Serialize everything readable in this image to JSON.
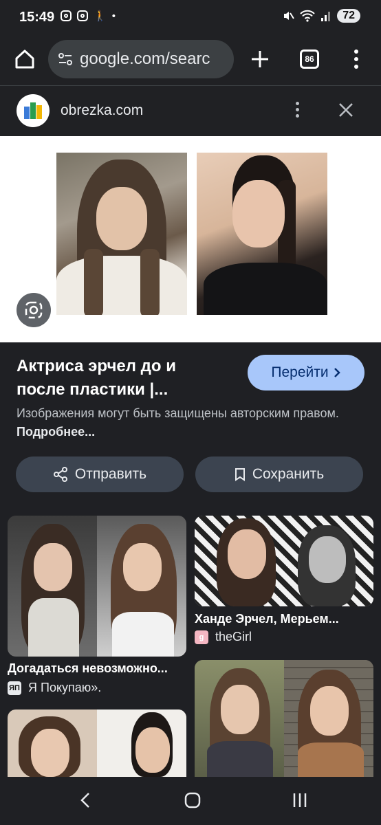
{
  "status_bar": {
    "time": "15:49",
    "battery": "72"
  },
  "toolbar": {
    "url": "google.com/searc",
    "tab_count": "86"
  },
  "source_bar": {
    "site": "obrezka.com"
  },
  "result": {
    "title": "Актриса эрчел до и после пластики |...",
    "go_label": "Перейти",
    "copyright_text": "Изображения могут быть защищены авторским правом.",
    "more_link": "Подробнее...",
    "share_label": "Отправить",
    "save_label": "Сохранить"
  },
  "related": [
    {
      "title": "Догадаться невозможно...",
      "source": "Я Покупаю».",
      "source_icon_text": "ЯП"
    },
    {
      "title": "Ханде Эрчел, Мерьем...",
      "source": "theGirl",
      "source_icon_text": "g"
    }
  ],
  "colors": {
    "accent_button": "#a8c7fa",
    "background": "#1f2024",
    "chip": "#3c4450"
  },
  "icons": [
    "home-icon",
    "tune-icon",
    "plus-icon",
    "tabs-icon",
    "more-vert-icon",
    "close-icon",
    "lens-icon",
    "chevron-right-icon",
    "share-icon",
    "bookmark-icon",
    "back-icon",
    "home-nav-icon",
    "recents-icon"
  ]
}
